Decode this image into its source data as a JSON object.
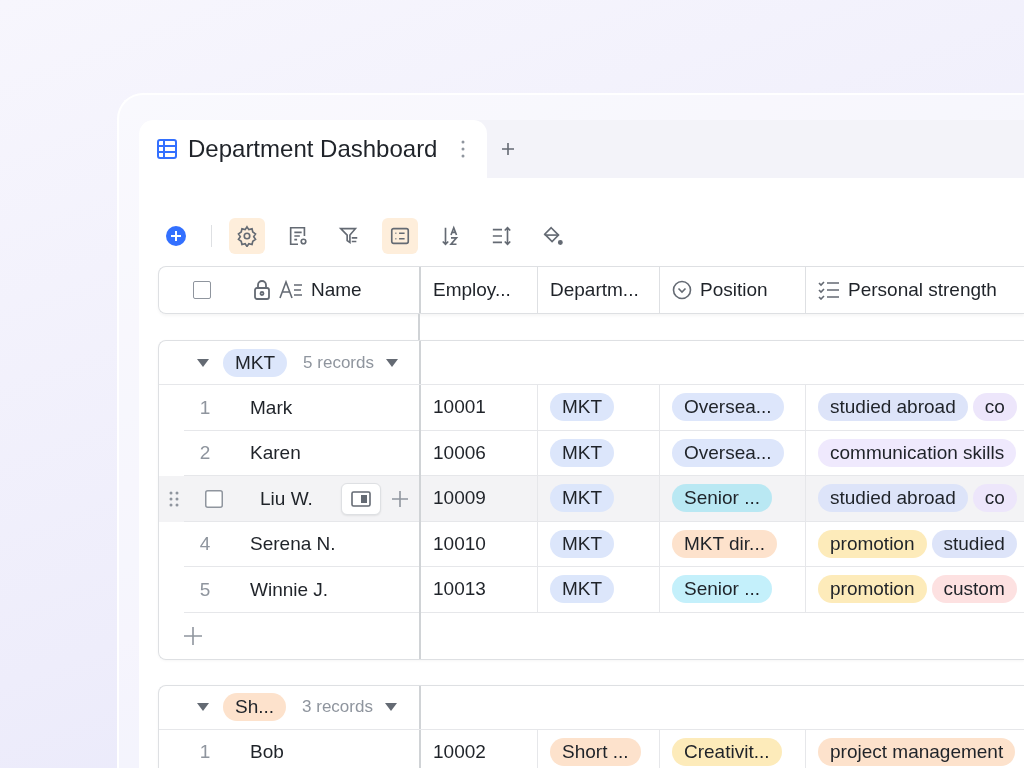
{
  "tabs": [
    {
      "label": "Department Dashboard",
      "selected": true
    }
  ],
  "toolbar": [
    {
      "kind": "add",
      "selected": false
    },
    {
      "kind": "settings",
      "selected": true
    },
    {
      "kind": "form",
      "selected": false
    },
    {
      "kind": "filter",
      "selected": false
    },
    {
      "kind": "group",
      "selected": true
    },
    {
      "kind": "sort",
      "selected": false
    },
    {
      "kind": "row-height",
      "selected": false
    },
    {
      "kind": "fill",
      "selected": false
    }
  ],
  "table": {
    "header_checked": false,
    "columns": [
      {
        "label": "Name",
        "kind": "text",
        "locked": true
      },
      {
        "label": "Employ...",
        "kind": "plain"
      },
      {
        "label": "Departm...",
        "kind": "plain"
      },
      {
        "label": "Position",
        "kind": "select"
      },
      {
        "label": "Personal strength",
        "kind": "multi"
      }
    ],
    "groups": [
      {
        "label": "MKT",
        "color": "#dce6fb",
        "count": "5 records",
        "expanded": true,
        "rows": [
          {
            "index": "1",
            "name": "Mark",
            "employee_id": "10001",
            "hovered": false,
            "department": {
              "label": "MKT",
              "color": "#dce6fb"
            },
            "position": {
              "label": "Oversea...",
              "color": "#dde6fb"
            },
            "strengths": [
              {
                "label": "studied abroad",
                "color": "#dde4f9"
              },
              {
                "label": "co",
                "color": "#ede6fb"
              }
            ]
          },
          {
            "index": "2",
            "name": "Karen",
            "employee_id": "10006",
            "hovered": false,
            "department": {
              "label": "MKT",
              "color": "#dce6fb"
            },
            "position": {
              "label": "Oversea...",
              "color": "#dde6fb"
            },
            "strengths": [
              {
                "label": "communication skills",
                "color": "#efe9fd"
              }
            ]
          },
          {
            "name": "Liu W.",
            "employee_id": "10009",
            "hovered": true,
            "checked": false,
            "department": {
              "label": "MKT",
              "color": "#dce6fb"
            },
            "position": {
              "label": "Senior ...",
              "color": "#b9e8f3"
            },
            "strengths": [
              {
                "label": "studied abroad",
                "color": "#dde4f9"
              },
              {
                "label": "co",
                "color": "#ede6fb"
              }
            ]
          },
          {
            "index": "4",
            "name": "Serena N.",
            "employee_id": "10010",
            "hovered": false,
            "department": {
              "label": "MKT",
              "color": "#dce6fb"
            },
            "position": {
              "label": "MKT dir...",
              "color": "#fde2cc"
            },
            "strengths": [
              {
                "label": "promotion",
                "color": "#fdebba"
              },
              {
                "label": "studied",
                "color": "#dde4f9"
              }
            ]
          },
          {
            "index": "5",
            "name": "Winnie J.",
            "employee_id": "10013",
            "hovered": false,
            "department": {
              "label": "MKT",
              "color": "#dce6fb"
            },
            "position": {
              "label": "Senior ...",
              "color": "#c4f0fb"
            },
            "strengths": [
              {
                "label": "promotion",
                "color": "#fdebba"
              },
              {
                "label": "custom",
                "color": "#fde1e1"
              }
            ]
          }
        ]
      },
      {
        "label": "Sh...",
        "color": "#fde2cc",
        "count": "3 records",
        "expanded": true,
        "rows": [
          {
            "index": "1",
            "name": "Bob",
            "employee_id": "10002",
            "hovered": false,
            "department": {
              "label": "Short ...",
              "color": "#fde2cc"
            },
            "position": {
              "label": "Creativit...",
              "color": "#fdebba"
            },
            "strengths": [
              {
                "label": "project management",
                "color": "#fde2cc"
              }
            ]
          }
        ]
      }
    ]
  }
}
